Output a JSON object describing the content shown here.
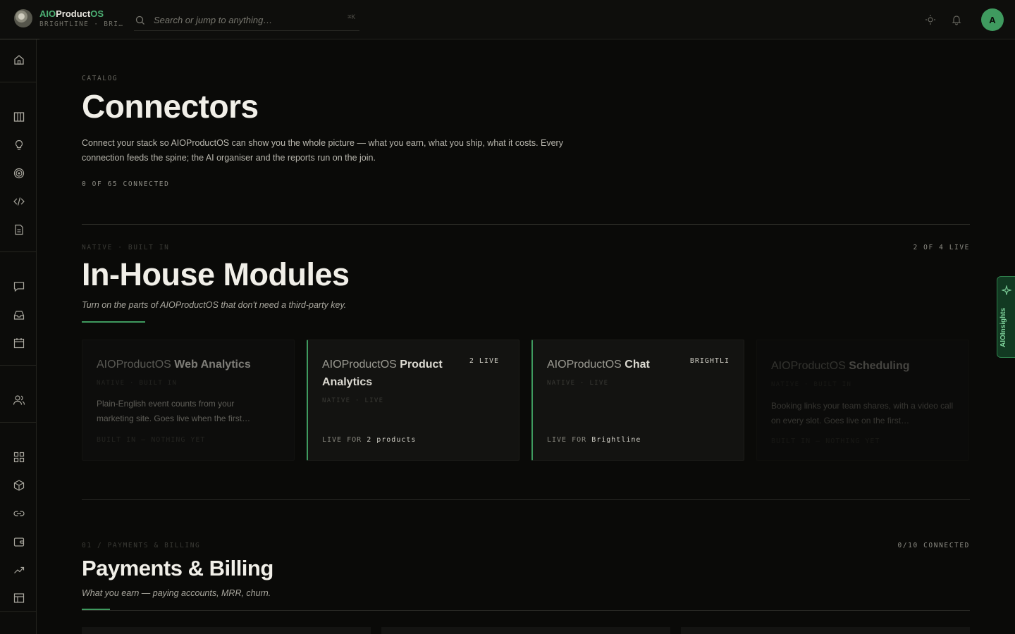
{
  "colors": {
    "accent": "#4caf73",
    "bg": "#0a0a08",
    "avatar": "#3f9a5f"
  },
  "brand": {
    "name_prefix": "AIO",
    "name_mid": "Product",
    "name_suffix": "OS",
    "sub": "BRIGHTLINE · BRI…"
  },
  "search": {
    "placeholder": "Search or jump to anything…",
    "shortcut": "⌘K"
  },
  "user": {
    "avatar_initial": "A"
  },
  "page": {
    "eyebrow": "CATALOG",
    "title": "Connectors",
    "description": "Connect your stack so AIOProductOS can show you the whole picture — what you earn, what you ship, what it costs. Every connection feeds the spine; the AI organiser and the reports run on the join.",
    "connected_count": "0 OF 65 CONNECTED"
  },
  "in_house": {
    "eyebrow": "NATIVE · BUILT IN",
    "status": "2 OF 4 LIVE",
    "title": "In-House Modules",
    "subtitle": "Turn on the parts of AIOProductOS that don't need a third-party key.",
    "cards": [
      {
        "prefix": "AIOProductOS",
        "name": "Web Analytics",
        "meta": "NATIVE · BUILT IN",
        "body": "Plain-English event counts from your marketing site. Goes live when the first…",
        "foot": "BUILT IN — NOTHING YET",
        "foot_value": "",
        "badge": ""
      },
      {
        "prefix": "AIOProductOS",
        "name": "Product Analytics",
        "meta": "NATIVE · LIVE",
        "body": "",
        "foot": "LIVE FOR",
        "foot_value": "2 products",
        "badge": "2 LIVE"
      },
      {
        "prefix": "AIOProductOS",
        "name": "Chat",
        "meta": "NATIVE · LIVE",
        "body": "",
        "foot": "LIVE FOR",
        "foot_value": "Brightline",
        "badge": "BRIGHTLI"
      },
      {
        "prefix": "AIOProductOS",
        "name": "Scheduling",
        "meta": "NATIVE · BUILT IN",
        "body": "Booking links your team shares, with a video call on every slot. Goes live on the first…",
        "foot": "BUILT IN — NOTHING YET",
        "foot_value": "",
        "badge": ""
      }
    ]
  },
  "payments": {
    "eyebrow": "01 / PAYMENTS & BILLING",
    "status": "0/10 CONNECTED",
    "title": "Payments & Billing",
    "subtitle": "What you earn — paying accounts, MRR, churn."
  },
  "insights_tab": {
    "label": "AIOInsights",
    "icon": "sparkle-icon"
  },
  "sidebar_icons": [
    "home-icon",
    "columns-icon",
    "lightbulb-icon",
    "target-icon",
    "code-icon",
    "document-icon",
    "chat-icon",
    "inbox-icon",
    "calendar-icon",
    "users-icon",
    "grid-icon",
    "box-icon",
    "link-icon",
    "wallet-icon",
    "trend-icon",
    "table-icon"
  ]
}
